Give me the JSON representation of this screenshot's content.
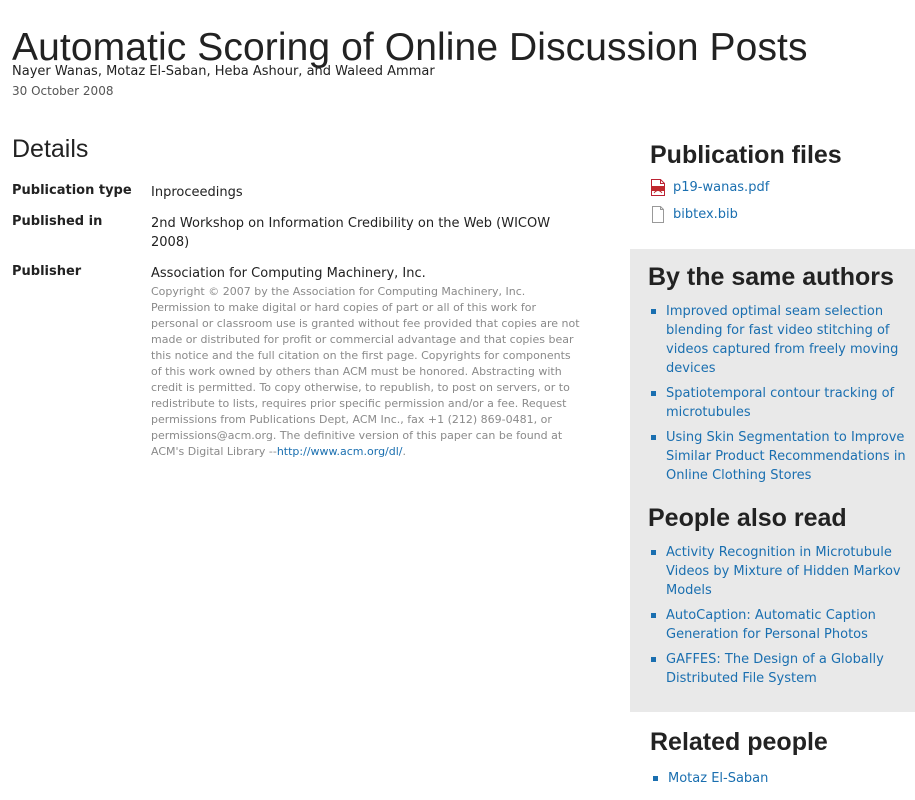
{
  "title": "Automatic Scoring of Online Discussion Posts",
  "authors": "Nayer Wanas, Motaz El-Saban, Heba Ashour, and Waleed Ammar",
  "date": "30 October 2008",
  "details": {
    "heading": "Details",
    "publication_type_label": "Publication type",
    "publication_type_value": "Inproceedings",
    "published_in_label": "Published in",
    "published_in_value": "2nd Workshop on Information Credibility on the Web (WICOW 2008)",
    "publisher_label": "Publisher",
    "publisher_value": "Association for Computing Machinery, Inc.",
    "copyright_text": "Copyright © 2007 by the Association for Computing Machinery, Inc. Permission to make digital or hard copies of part or all of this work for personal or classroom use is granted without fee provided that copies are not made or distributed for profit or commercial advantage and that copies bear this notice and the full citation on the first page. Copyrights for components of this work owned by others than ACM must be honored. Abstracting with credit is permitted. To copy otherwise, to republish, to post on servers, or to redistribute to lists, requires prior specific permission and/or a fee. Request permissions from Publications Dept, ACM Inc., fax +1 (212) 869-0481, or permissions@acm.org. The definitive version of this paper can be found at ACM's Digital Library --",
    "copyright_link": "http://www.acm.org/dl/",
    "copyright_end": "."
  },
  "publication_files": {
    "heading": "Publication files",
    "files": [
      {
        "name": "p19-wanas.pdf",
        "icon": "pdf-file-icon"
      },
      {
        "name": "bibtex.bib",
        "icon": "document-file-icon"
      }
    ]
  },
  "same_authors": {
    "heading": "By the same authors",
    "items": [
      "Improved optimal seam selection blending for fast video stitching of videos captured from freely moving devices",
      "Spatiotemporal contour tracking of microtubules",
      "Using Skin Segmentation to Improve Similar Product Recommendations in Online Clothing Stores"
    ]
  },
  "people_also_read": {
    "heading": "People also read",
    "items": [
      "Activity Recognition in Microtubule Videos by Mixture of Hidden Markov Models",
      "AutoCaption: Automatic Caption Generation for Personal Photos",
      "GAFFES: The Design of a Globally Distributed File System"
    ]
  },
  "related_people": {
    "heading": "Related people",
    "items": [
      "Motaz El-Saban"
    ]
  },
  "colors": {
    "link": "#1a6fb0",
    "sidebar_bg": "#e9e9e9",
    "muted_text": "#8a8a8a",
    "pdf_icon": "#c0282d"
  }
}
